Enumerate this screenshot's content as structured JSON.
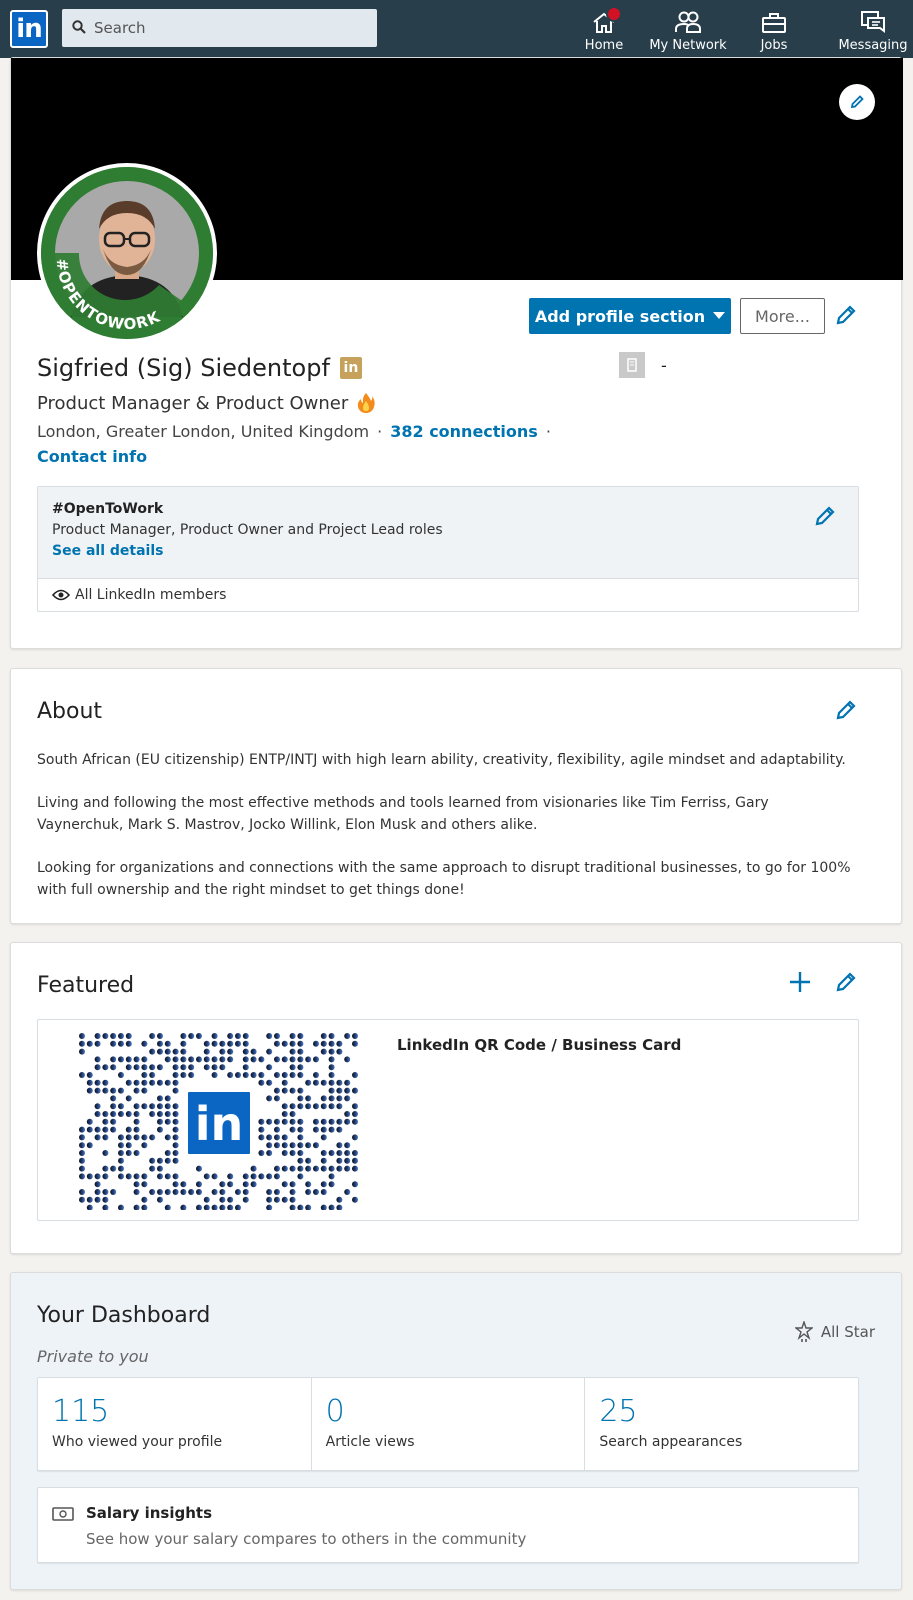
{
  "nav": {
    "search_placeholder": "Search",
    "items": [
      {
        "label": "Home",
        "icon": "home-icon"
      },
      {
        "label": "My Network",
        "icon": "my-network-icon"
      },
      {
        "label": "Jobs",
        "icon": "jobs-icon"
      },
      {
        "label": "Messaging",
        "icon": "messaging-icon"
      }
    ]
  },
  "profile": {
    "avatar_frame_text": "#OPENTOWORK",
    "add_section_label": "Add profile section",
    "more_label": "More...",
    "name": "Sigfried (Sig) Siedentopf",
    "name_badge": "in",
    "company_dash": "-",
    "headline": "Product Manager & Product Owner",
    "location": "London, Greater London, United Kingdom",
    "connections": "382 connections",
    "contact_info": "Contact info",
    "open_to_work": {
      "title": "#OpenToWork",
      "roles": "Product Manager, Product Owner and Project Lead roles",
      "see_all": "See all details",
      "visibility": "All LinkedIn members"
    }
  },
  "about": {
    "title": "About",
    "paragraphs": [
      "South African (EU citizenship) ENTP/INTJ with high learn ability, creativity, flexibility, agile mindset and adaptability.",
      "Living and following the most effective methods and tools learned from visionaries like Tim Ferriss, Gary Vaynerchuk, Mark S. Mastrov, Jocko Willink, Elon Musk and others alike.",
      "Looking for organizations and connections with the same approach to disrupt traditional businesses, to go for 100% with full ownership and the right mindset to get things done!"
    ]
  },
  "featured": {
    "title": "Featured",
    "item_title": "LinkedIn QR Code / Business Card",
    "qr_logo": "in"
  },
  "dashboard": {
    "title": "Your Dashboard",
    "subtitle": "Private to you",
    "level": "All Star",
    "stats": [
      {
        "value": "115",
        "label": "Who viewed your profile"
      },
      {
        "value": "0",
        "label": "Article views"
      },
      {
        "value": "25",
        "label": "Search appearances"
      }
    ],
    "salary_title": "Salary insights",
    "salary_sub": "See how your salary compares to others in the community"
  },
  "colors": {
    "nav_bg": "#283e4a",
    "brand_blue": "#0073b1",
    "open_to_work_green": "#2f7d32",
    "badge_red": "#d11124"
  }
}
